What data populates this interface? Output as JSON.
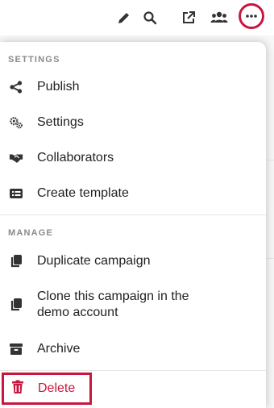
{
  "toolbar": {
    "icons": [
      "pencil-icon",
      "search-icon",
      "external-link-icon",
      "users-icon",
      "more-icon"
    ],
    "highlight_color": "#c8173f"
  },
  "menu": {
    "settings_section": {
      "title": "SETTINGS",
      "items": [
        {
          "label": "Publish",
          "icon": "share-icon"
        },
        {
          "label": "Settings",
          "icon": "gears-icon"
        },
        {
          "label": "Collaborators",
          "icon": "handshake-icon"
        },
        {
          "label": "Create template",
          "icon": "template-icon"
        }
      ]
    },
    "manage_section": {
      "title": "MANAGE",
      "items": [
        {
          "label": "Duplicate campaign",
          "icon": "copy-icon"
        },
        {
          "label_line1": "Clone this campaign in the",
          "label_line2": "demo account",
          "icon": "copy-icon"
        },
        {
          "label": "Archive",
          "icon": "archive-icon"
        }
      ]
    },
    "delete": {
      "label": "Delete",
      "icon": "trash-icon",
      "color": "#c8173f"
    }
  }
}
